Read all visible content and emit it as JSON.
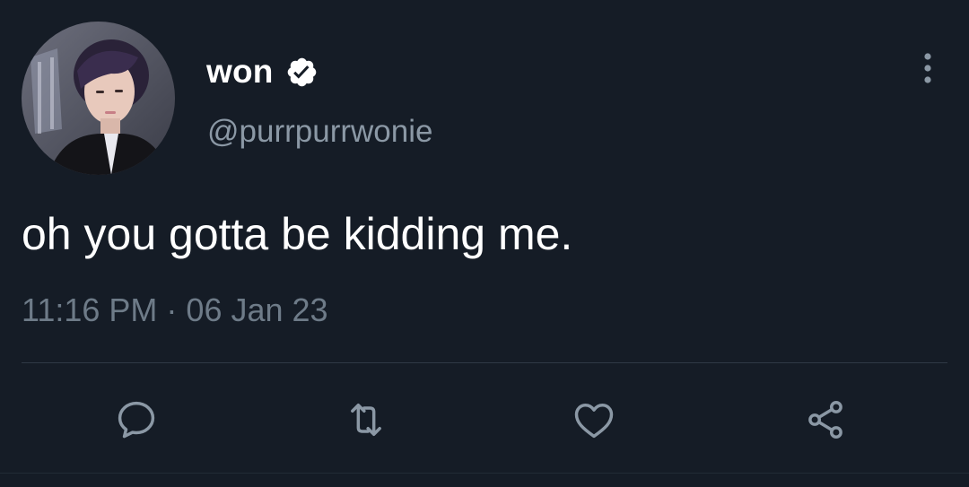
{
  "tweet": {
    "display_name": "won",
    "handle": "@purrpurrwonie",
    "verified": true,
    "text": "oh you gotta be kidding me.",
    "time": "11:16 PM",
    "separator": "·",
    "date": "06 Jan 23"
  },
  "actions": [
    {
      "name": "reply",
      "icon": "reply-icon"
    },
    {
      "name": "retweet",
      "icon": "retweet-icon"
    },
    {
      "name": "like",
      "icon": "heart-icon"
    },
    {
      "name": "share",
      "icon": "share-icon"
    }
  ],
  "colors": {
    "background": "#151c26",
    "secondary_text": "#8b98a5",
    "meta_text": "#6e7b88",
    "icon": "#8b98a5"
  }
}
